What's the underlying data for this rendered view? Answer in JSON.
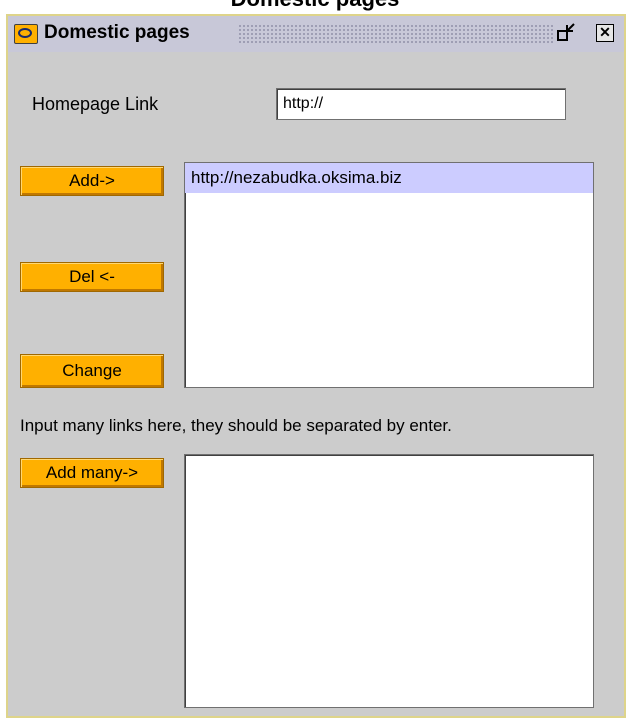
{
  "partial_title": "Domestic pages",
  "window": {
    "title": "Domestic pages"
  },
  "homepage": {
    "label": "Homepage Link",
    "value": "http://"
  },
  "buttons": {
    "add": "Add->",
    "del": "Del <-",
    "change": "Change",
    "add_many": "Add many->"
  },
  "links_list": {
    "items": [
      "http://nezabudka.oksima.biz"
    ],
    "selected_index": 0
  },
  "instruction": "Input many links here, they should be separated by enter.",
  "colors": {
    "button_bg": "#ffb000",
    "selection": "#ccccff",
    "window_bg": "#cccccc"
  }
}
